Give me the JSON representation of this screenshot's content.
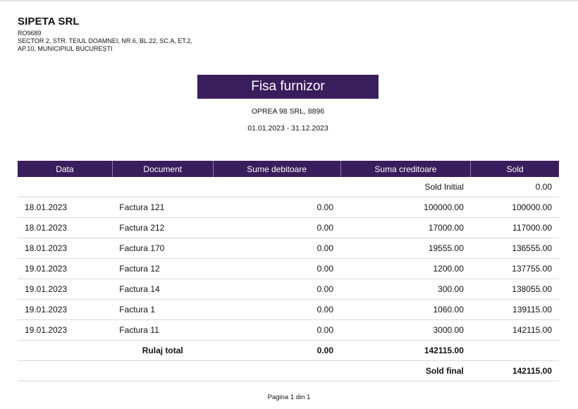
{
  "company": {
    "name": "SIPETA SRL",
    "code": "RO9689",
    "address": "SECTOR 2, STR. TEIUL DOAMNEI, NR.6, BL.22, SC.A, ET.2, AP.10, MUNICIPIUL BUCUREȘTI"
  },
  "report": {
    "title": "Fisa furnizor",
    "supplier": "OPREA 98 SRL, 8896",
    "period": "01.01.2023 - 31.12.2023"
  },
  "table": {
    "headers": [
      "Data",
      "Document",
      "Sume debitoare",
      "Suma creditoare",
      "Sold"
    ],
    "initial": {
      "label": "Sold Initial",
      "value": "0.00"
    },
    "rows": [
      [
        "18.01.2023",
        "Factura 121",
        "0.00",
        "100000.00",
        "100000.00"
      ],
      [
        "18.01.2023",
        "Factura 212",
        "0.00",
        "17000.00",
        "117000.00"
      ],
      [
        "18.01.2023",
        "Factura 170",
        "0.00",
        "19555.00",
        "136555.00"
      ],
      [
        "19.01.2023",
        "Factura 12",
        "0.00",
        "1200.00",
        "137755.00"
      ],
      [
        "19.01.2023",
        "Factura 14",
        "0.00",
        "300.00",
        "138055.00"
      ],
      [
        "19.01.2023",
        "Factura 1",
        "0.00",
        "1060.00",
        "139115.00"
      ],
      [
        "19.01.2023",
        "Factura 11",
        "0.00",
        "3000.00",
        "142115.00"
      ]
    ],
    "total": {
      "label": "Rulaj total",
      "debit": "0.00",
      "credit": "142115.00"
    },
    "final": {
      "label": "Sold final",
      "value": "142115.00"
    }
  },
  "footer": {
    "page": "Pagina 1 din 1"
  },
  "colors": {
    "accent": "#3a1d5c"
  }
}
